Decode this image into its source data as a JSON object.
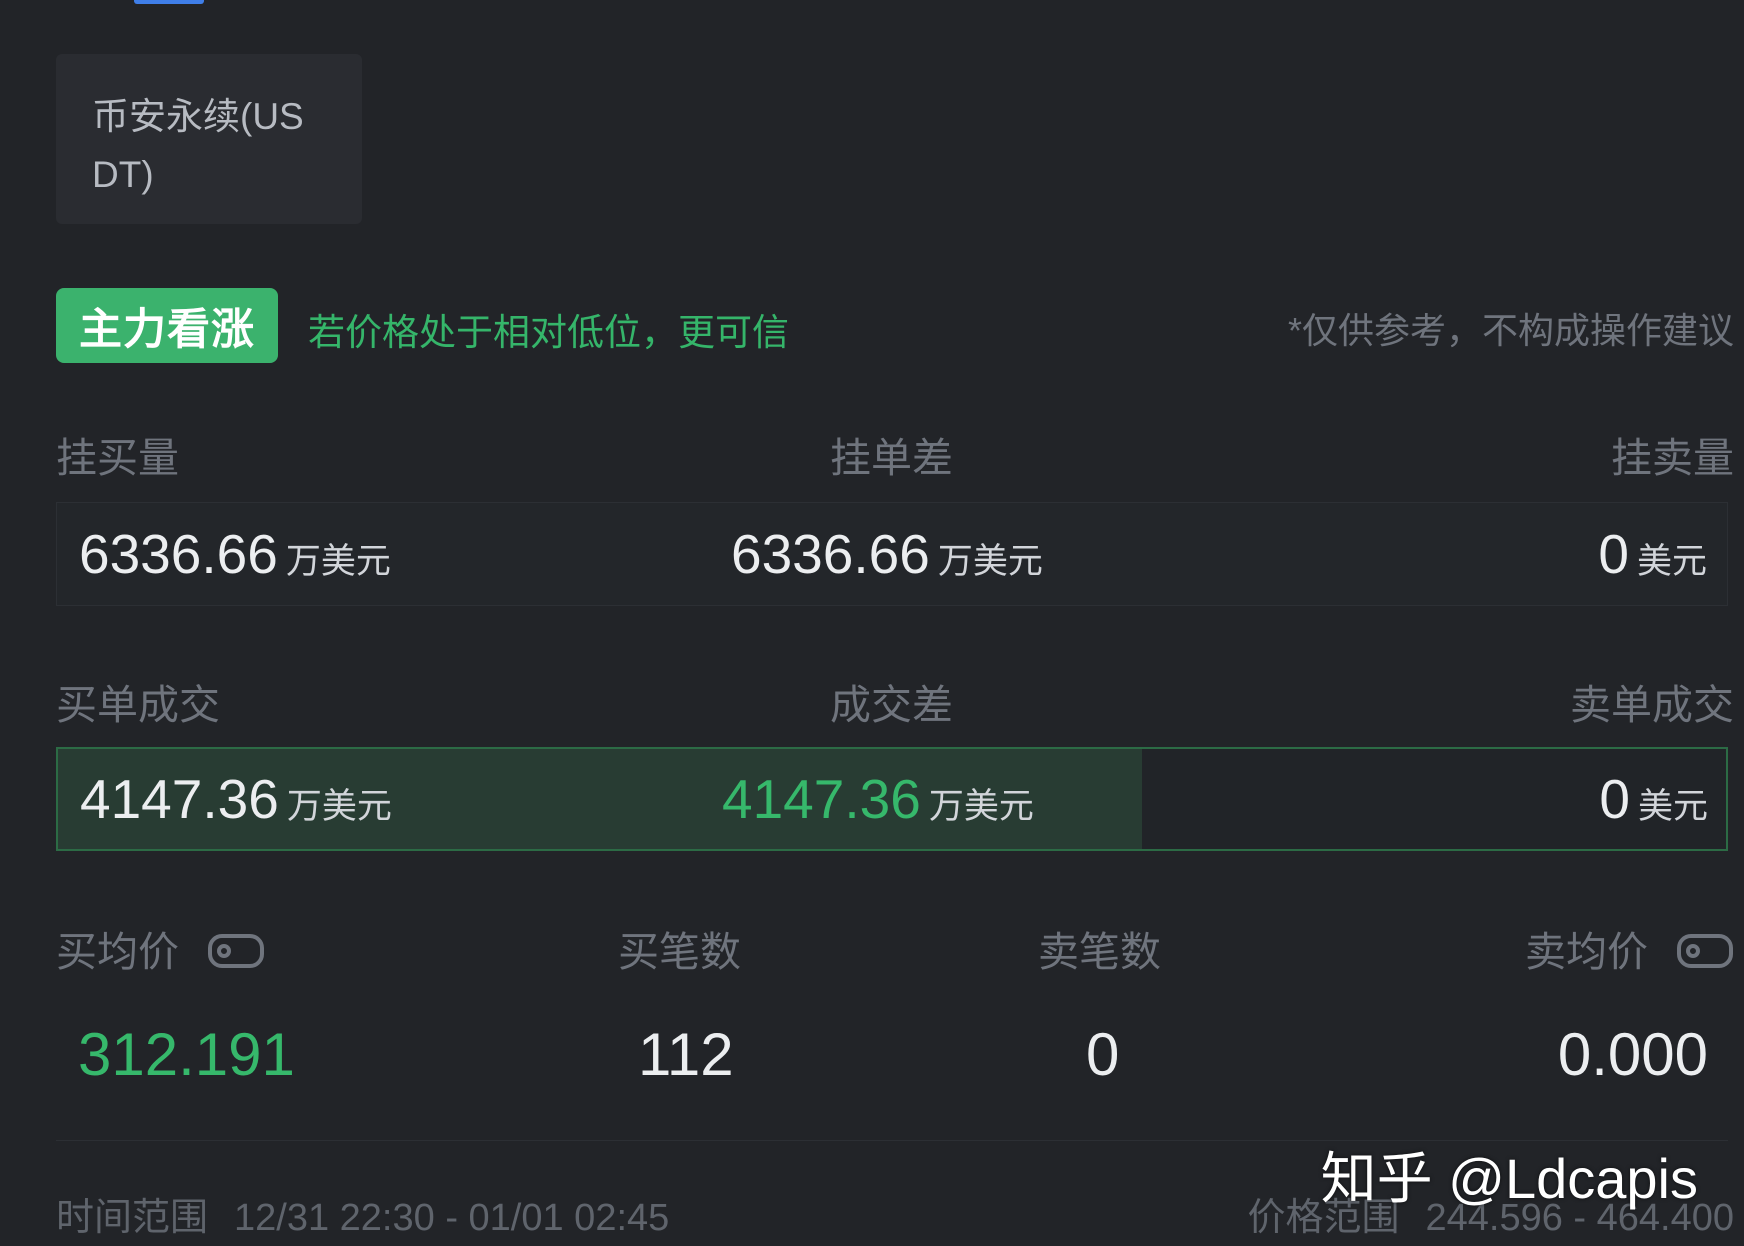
{
  "exchange": {
    "label": "币安永续(USDT)"
  },
  "signal": {
    "badge": "主力看涨",
    "hint": "若价格处于相对低位，更可信",
    "disclaimer": "*仅供参考，不构成操作建议",
    "color": "#3bb26d"
  },
  "order_book": {
    "labels": {
      "buy": "挂买量",
      "diff": "挂单差",
      "sell": "挂卖量"
    },
    "buy": {
      "value": "6336.66",
      "unit": "万美元"
    },
    "diff": {
      "value": "6336.66",
      "unit": "万美元"
    },
    "sell": {
      "value": "0",
      "unit": "美元"
    }
  },
  "trades": {
    "labels": {
      "buy": "买单成交",
      "diff": "成交差",
      "sell": "卖单成交"
    },
    "buy": {
      "value": "4147.36",
      "unit": "万美元"
    },
    "diff": {
      "value": "4147.36",
      "unit": "万美元"
    },
    "sell": {
      "value": "0",
      "unit": "美元"
    },
    "buy_fill_percent": 65
  },
  "stats": {
    "labels": {
      "buy_avg": "买均价",
      "buy_count": "买笔数",
      "sell_count": "卖笔数",
      "sell_avg": "卖均价"
    },
    "buy_avg": "312.191",
    "buy_count": "112",
    "sell_count": "0",
    "sell_avg": "0.000",
    "icons": [
      "tag-icon",
      "tag-icon"
    ]
  },
  "footer": {
    "time_label": "时间范围",
    "time_value": "12/31 22:30 - 01/01 02:45",
    "price_label": "价格范围",
    "price_value": "244.596 - 464.400"
  },
  "watermark": "知乎 @Ldcapis",
  "colors": {
    "positive": "#36b86b",
    "accent": "#3f7ee8",
    "background": "#222428"
  }
}
